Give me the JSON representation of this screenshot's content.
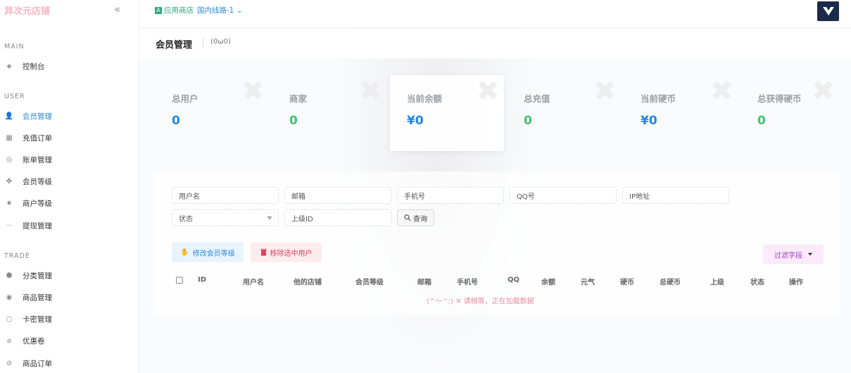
{
  "brand": "异次元店铺",
  "sidebar": {
    "collapse_icon": "«",
    "sections": {
      "main": "MAIN",
      "user": "USER",
      "trade": "TRADE"
    },
    "items": [
      {
        "label": "控制台",
        "icon": "◈"
      },
      {
        "label": "会员管理",
        "icon": "👤"
      },
      {
        "label": "充值订单",
        "icon": "▦"
      },
      {
        "label": "账单管理",
        "icon": "◎"
      },
      {
        "label": "会员等级",
        "icon": "✤"
      },
      {
        "label": "商户等级",
        "icon": "★"
      },
      {
        "label": "提现管理",
        "icon": "⋯"
      },
      {
        "label": "分类管理",
        "icon": "⬢"
      },
      {
        "label": "商品管理",
        "icon": "◉"
      },
      {
        "label": "卡密管理",
        "icon": "○"
      },
      {
        "label": "优惠卷",
        "icon": "⌀"
      },
      {
        "label": "商品订单",
        "icon": "⊘"
      }
    ]
  },
  "topbar": {
    "store_label": "应用商店",
    "store_icon": "A",
    "line_label": "国内线路-1",
    "line_caret": "⌄"
  },
  "page": {
    "title": "会员管理",
    "subtitle": "(0ω0)"
  },
  "stats": [
    {
      "label": "总用户",
      "value": "0",
      "color": "blue"
    },
    {
      "label": "商家",
      "value": "0",
      "color": "green"
    },
    {
      "label": "当前余额",
      "value": "¥0",
      "color": "blue"
    },
    {
      "label": "总充值",
      "value": "0",
      "color": "green"
    },
    {
      "label": "当前硬币",
      "value": "¥0",
      "color": "blue"
    },
    {
      "label": "总获得硬币",
      "value": "0",
      "color": "green"
    }
  ],
  "filters": {
    "username": "用户名",
    "email": "邮箱",
    "phone": "手机号",
    "qq": "QQ号",
    "ip": "IP地址",
    "status": "状态",
    "parent": "上级ID",
    "query_btn": "查询"
  },
  "actions": {
    "modify_level": "修改会员等级",
    "remove_selected": "移除选中用户",
    "filter_fields": "过滤字段"
  },
  "table": {
    "headers": [
      "ID",
      "用户名",
      "他的店铺",
      "会员等级",
      "邮箱",
      "手机号",
      "QQ",
      "余额",
      "元气",
      "硬币",
      "总硬币",
      "上级",
      "状态",
      "操作"
    ],
    "loading_text": "(^～^;) ✕ 请稍等，正在加载数据"
  }
}
